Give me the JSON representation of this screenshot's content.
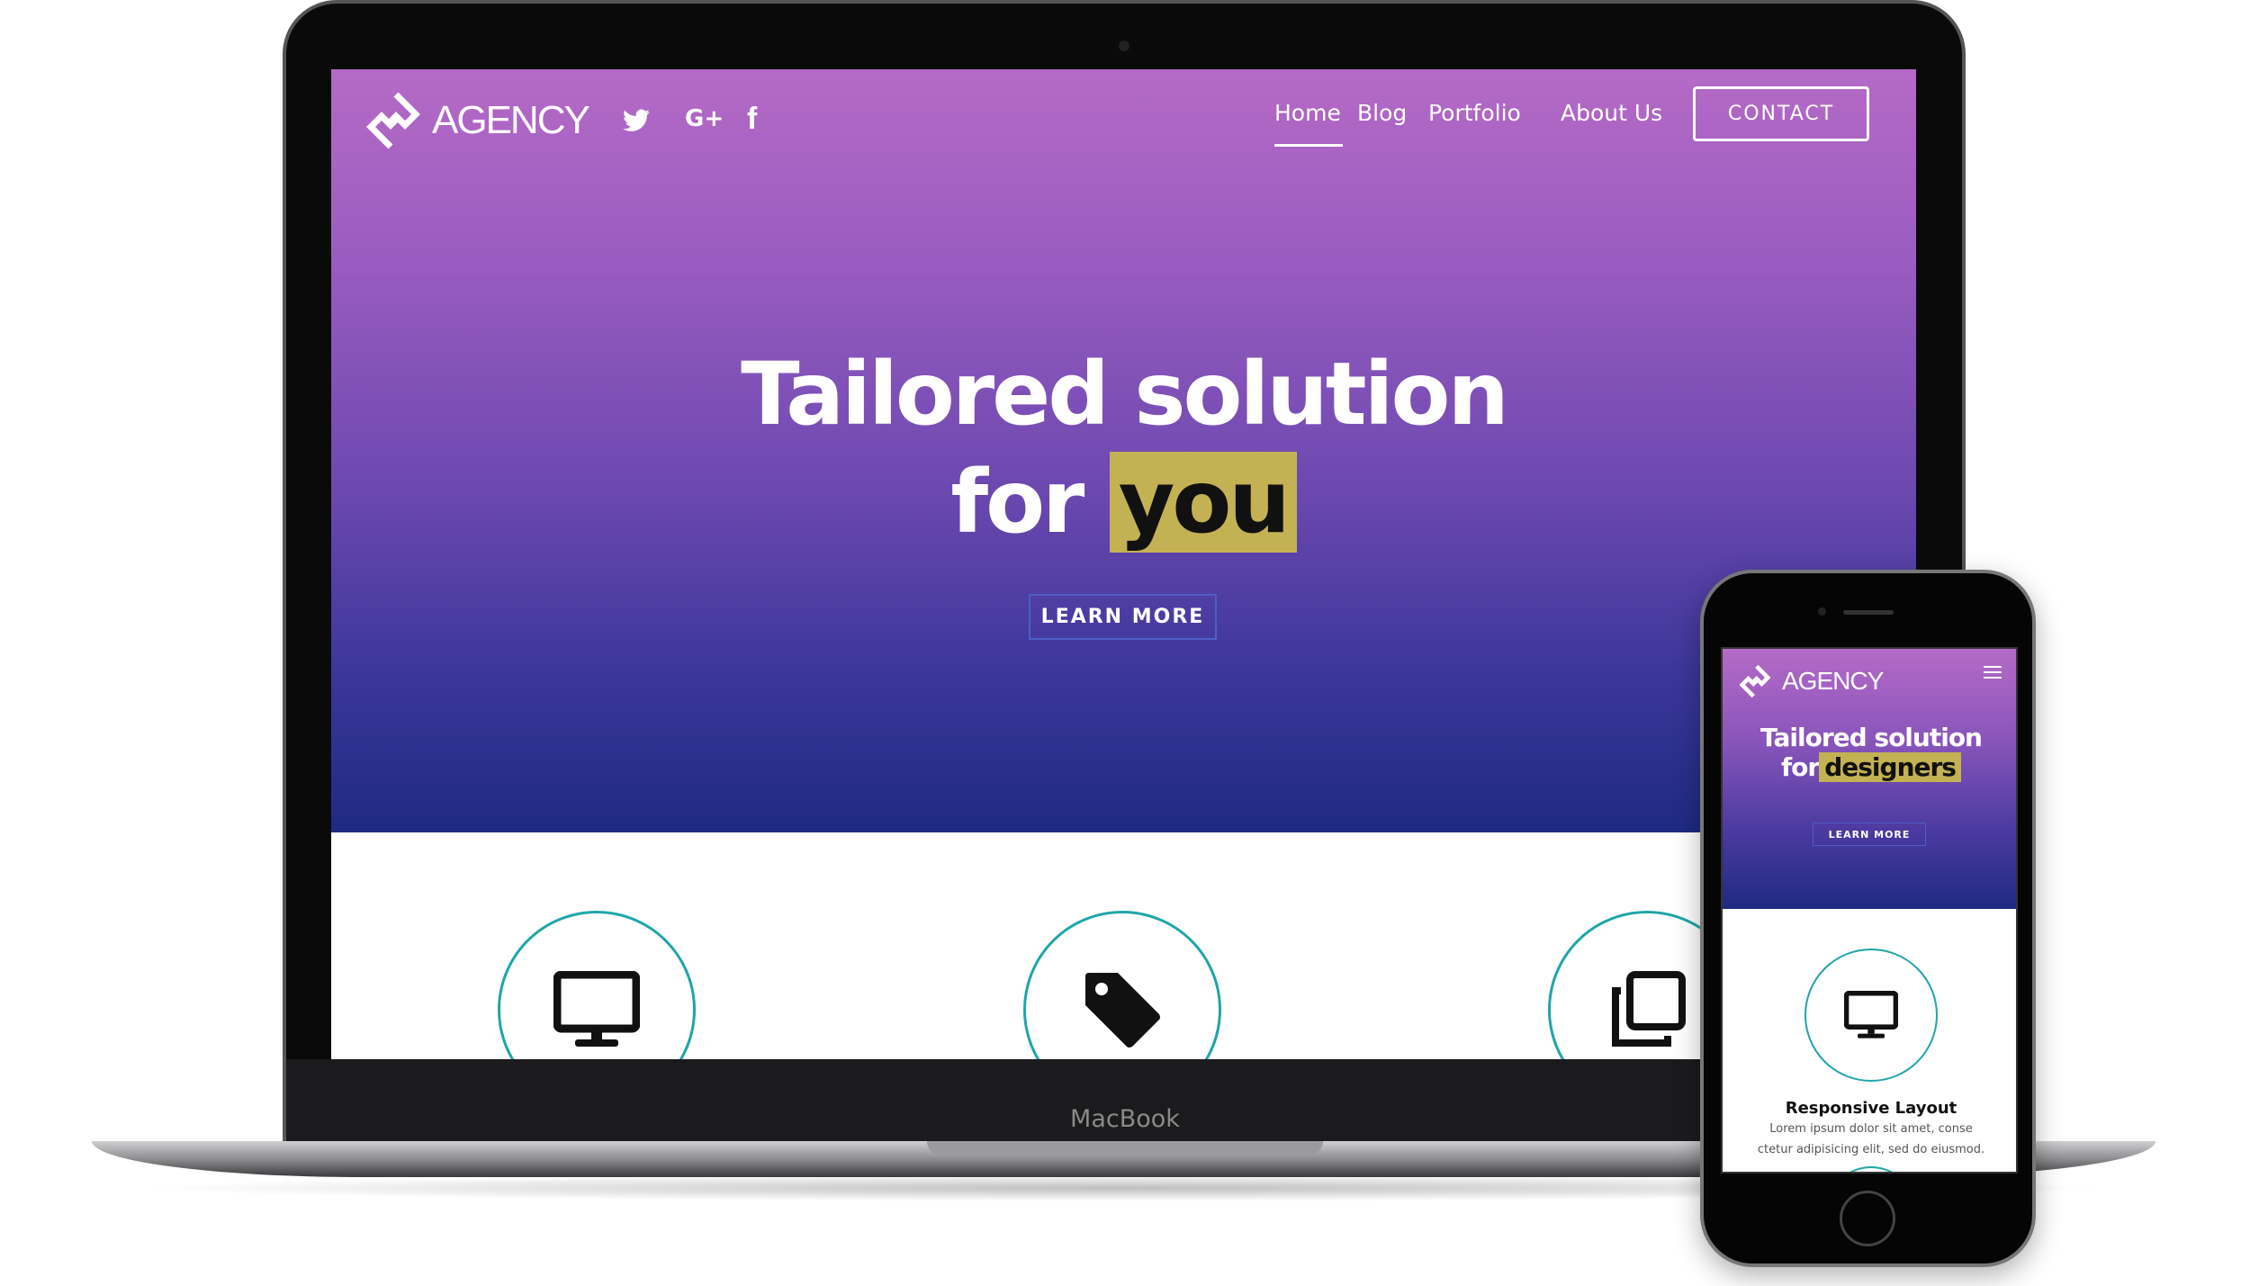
{
  "laptop": {
    "brand_label": "MacBook",
    "header": {
      "logo_text": "AGENCY",
      "social": [
        "twitter-icon",
        "google-plus-icon",
        "facebook-icon"
      ],
      "nav": [
        {
          "label": "Home",
          "active": true
        },
        {
          "label": "Blog"
        },
        {
          "label": "Portfolio"
        },
        {
          "label": "About Us"
        }
      ],
      "contact_label": "CONTACT"
    },
    "hero": {
      "line1": "Tailored solution",
      "line2_prefix": "for",
      "line2_highlight": "you",
      "cta": "LEARN MORE"
    },
    "features": [
      {
        "icon": "monitor-icon"
      },
      {
        "icon": "tag-icon"
      },
      {
        "icon": "copy-icon"
      }
    ]
  },
  "phone": {
    "logo_text": "AGENCY",
    "menu_icon": "hamburger-icon",
    "hero": {
      "line1": "Tailored solution",
      "line2_prefix": "for",
      "line2_highlight": "designers",
      "cta": "LEARN MORE"
    },
    "feature": {
      "icon": "monitor-icon",
      "title": "Responsive Layout",
      "text_line1": "Lorem ipsum dolor sit amet, conse",
      "text_line2": "ctetur adipisicing elit, sed do eiusmod."
    }
  },
  "colors": {
    "highlight": "#c4b153",
    "accent_circle": "#1fa5a8",
    "gradient_top": "#b56ac6",
    "gradient_bottom": "#1e2a82"
  }
}
